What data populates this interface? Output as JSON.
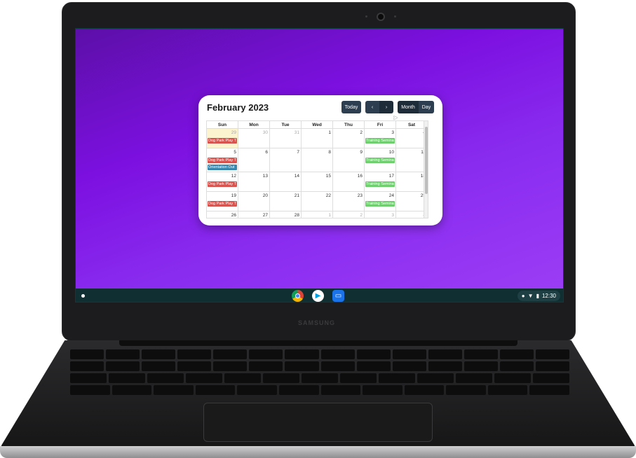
{
  "device": {
    "brand": "SAMSUNG"
  },
  "calendar": {
    "title": "February 2023",
    "buttons": {
      "today": "Today",
      "prev": "‹",
      "next": "›",
      "month": "Month",
      "day": "Day"
    },
    "weekdays": [
      "Sun",
      "Mon",
      "Tue",
      "Wed",
      "Thu",
      "Fri",
      "Sat"
    ],
    "weeks": [
      {
        "days": [
          "29",
          "30",
          "31",
          "1",
          "2",
          "3",
          "4"
        ]
      },
      {
        "days": [
          "5",
          "6",
          "7",
          "8",
          "9",
          "10",
          "11"
        ]
      },
      {
        "days": [
          "12",
          "13",
          "14",
          "15",
          "16",
          "17",
          "18"
        ]
      },
      {
        "days": [
          "19",
          "20",
          "21",
          "22",
          "23",
          "24",
          "25"
        ]
      },
      {
        "days": [
          "26",
          "27",
          "28",
          "1",
          "2",
          "3",
          "4"
        ]
      }
    ],
    "events": {
      "dog_park": "Dog Park Play T",
      "orientation": "Orientation Out",
      "training": "Training Semina"
    },
    "colors": {
      "dog_park": "#d9534f",
      "orientation": "#3a87ad",
      "training": "#6fcf6f",
      "today_highlight": "#fcf3cf"
    }
  },
  "shelf": {
    "apps": [
      {
        "name": "chrome-icon"
      },
      {
        "name": "play-store-icon"
      },
      {
        "name": "files-icon"
      }
    ],
    "time": "12:30",
    "status_icons": [
      "account-icon",
      "wifi-icon",
      "battery-icon"
    ]
  },
  "wallpaper": {
    "colors": [
      "#5c0fa8",
      "#9b3cf5"
    ]
  }
}
